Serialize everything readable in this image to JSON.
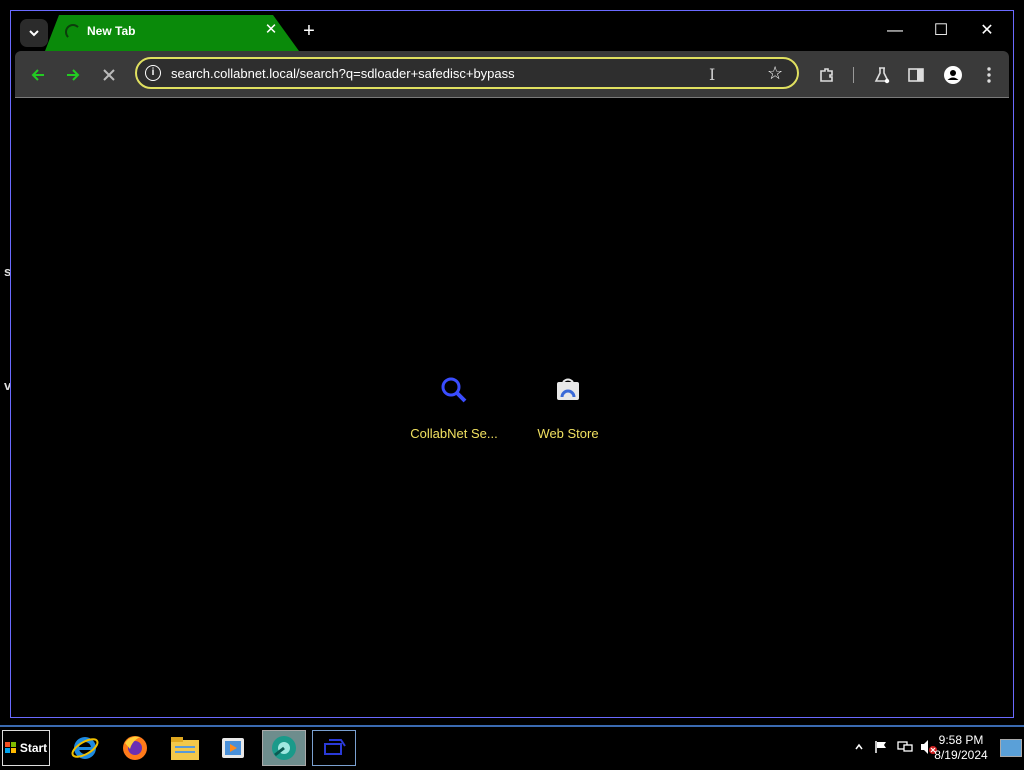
{
  "browser": {
    "tab": {
      "title": "New Tab"
    },
    "address": {
      "url": "search.collabnet.local/search?q=sdloader+safedisc+bypass"
    },
    "colors": {
      "tab_accent": "#0a8a0a",
      "omnibox_border": "#e0e060",
      "nav_arrow": "#22cc22"
    }
  },
  "shortcuts": [
    {
      "label": "CollabNet Se...",
      "icon": "search-icon"
    },
    {
      "label": "Web Store",
      "icon": "web-store-icon"
    }
  ],
  "taskbar": {
    "start_label": "Start",
    "apps": [
      "internet-explorer-icon",
      "firefox-icon",
      "file-explorer-icon",
      "media-player-icon",
      "chrome-app-icon",
      "network-app-icon"
    ],
    "clock": {
      "time": "9:58 PM",
      "date": "8/19/2024"
    }
  }
}
